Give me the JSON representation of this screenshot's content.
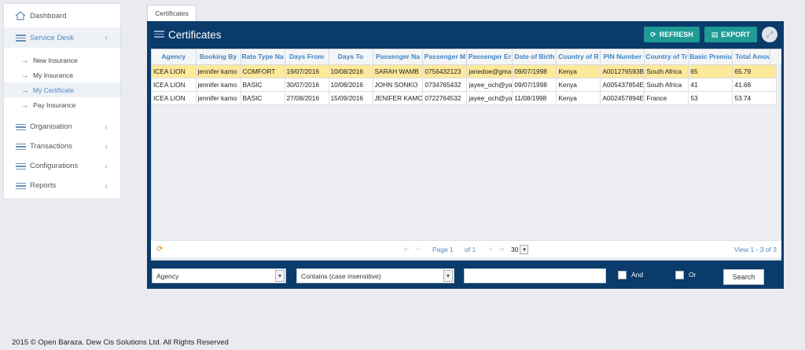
{
  "sidebar": {
    "dashboard": "Dashboard",
    "service_desk": "Service Desk",
    "sub_items": [
      "New Insurance",
      "My Insurance",
      "My Certificate",
      "Pay Insurance"
    ],
    "organisation": "Organisation",
    "transactions": "Transactions",
    "configurations": "Configurations",
    "reports": "Reports"
  },
  "tab": {
    "label": "Certificates"
  },
  "panel": {
    "title": "Certificates",
    "refresh_label": "REFRESH",
    "export_label": "EXPORT"
  },
  "table": {
    "columns": [
      "Agency",
      "Booking By",
      "Rate Type Na",
      "Days From",
      "Days To",
      "Passenger Na",
      "Passenger M",
      "Passenger Er",
      "Date of Birth",
      "Country of R",
      "PIN Number",
      "Country of Tr",
      "Basic Premiu",
      "Total Amour"
    ],
    "rows": [
      [
        "ICEA LION",
        "jennifer kamo",
        "COMFORT",
        "19/07/2016",
        "10/08/2016",
        "SARAH WAMB",
        "0756432123",
        "janedoe@gma",
        "09/07/1998",
        "Kenya",
        "A001276593B",
        "South Africa",
        "65",
        "65.79"
      ],
      [
        "ICEA LION",
        "jennifer kamo",
        "BASIC",
        "30/07/2016",
        "10/08/2016",
        "JOHN SONKO",
        "0734765432",
        "jayee_och@ya",
        "09/07/1998",
        "Kenya",
        "A005437854E",
        "South Africa",
        "41",
        "41.68"
      ],
      [
        "ICEA LION",
        "jennifer kamo",
        "BASIC",
        "27/08/2016",
        "15/09/2016",
        "JENIFER KAMC",
        "0722764532",
        "jayee_och@ya",
        "11/08/1998",
        "Kenya",
        "A002457894E",
        "France",
        "53",
        "53.74"
      ]
    ]
  },
  "pager": {
    "page_label": "Page",
    "page_value": "1",
    "of_label": "of 1",
    "rows_per_page": "30",
    "view_text": "View 1 - 3 of 3"
  },
  "filter": {
    "field": "Agency",
    "operator": "Contains (case insensitive)",
    "value": "",
    "and_label": "And",
    "or_label": "Or",
    "search_label": "Search"
  },
  "footer": {
    "brand": "2015 © Open Baraza.",
    "company": " Dew Cis Solutions Ltd. All Rights Reserved"
  },
  "colors": {
    "panel_bg": "#0a3b6b",
    "button_teal": "#1f9a94",
    "selected_row": "#fde99a",
    "link_blue": "#4a89c8"
  }
}
